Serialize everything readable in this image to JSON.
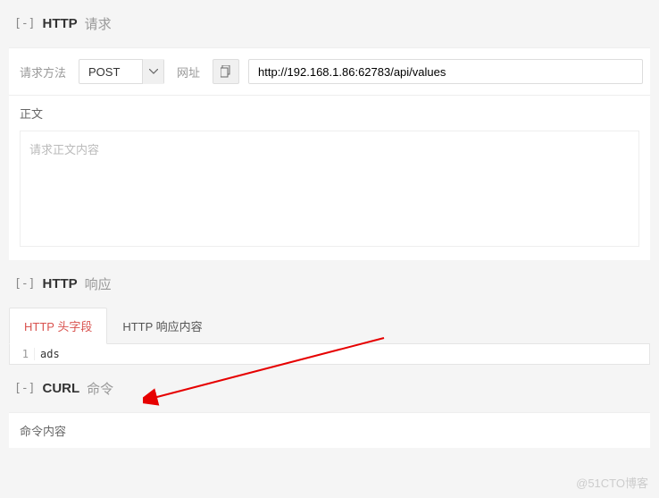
{
  "request": {
    "toggle": "[-]",
    "title_strong": "HTTP",
    "title_light": "请求",
    "method_label": "请求方法",
    "method_value": "POST",
    "url_label": "网址",
    "url_value": "http://192.168.1.86:62783/api/values",
    "body_label": "正文",
    "body_placeholder": "请求正文内容"
  },
  "response": {
    "toggle": "[-]",
    "title_strong": "HTTP",
    "title_light": "响应",
    "tabs": {
      "headers": "HTTP 头字段",
      "content": "HTTP 响应内容"
    },
    "body_lineno": "1",
    "body_content": "ads"
  },
  "curl": {
    "toggle": "[-]",
    "title_strong": "CURL",
    "title_light": "命令",
    "content_label": "命令内容"
  },
  "watermark": "@51CTO博客"
}
